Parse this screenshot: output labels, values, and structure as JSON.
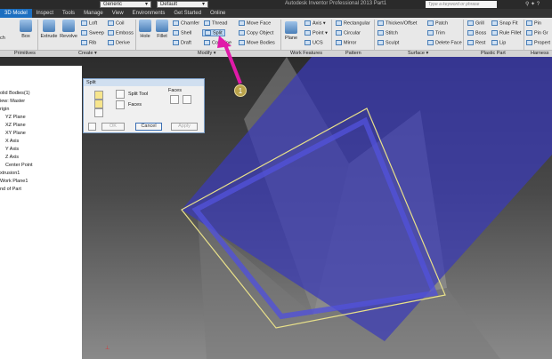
{
  "titlebar": {
    "appearance_value": "Generic",
    "style_value": "Default",
    "app_title": "Autodesk Inventor Professional 2013    Part1",
    "search_placeholder": "Type a keyword or phrase"
  },
  "tabs": [
    {
      "label": "3D Model",
      "active": true
    },
    {
      "label": "Inspect"
    },
    {
      "label": "Tools"
    },
    {
      "label": "Manage"
    },
    {
      "label": "View"
    },
    {
      "label": "Environments"
    },
    {
      "label": "Get Started"
    },
    {
      "label": "Online"
    }
  ],
  "ribbon": {
    "sketch": "ch",
    "box": "Box",
    "extrude": "Extrude",
    "revolve": "Revolve",
    "loft": "Loft",
    "sweep": "Sweep",
    "rib": "Rib",
    "coil": "Coil",
    "emboss": "Emboss",
    "derive": "Derive",
    "hole": "Hole",
    "fillet": "Fillet",
    "chamfer": "Chamfer",
    "shell": "Shell",
    "draft": "Draft",
    "thread": "Thread",
    "split": "Split",
    "combine": "Combine",
    "move_face": "Move Face",
    "copy_object": "Copy Object",
    "move_bodies": "Move Bodies",
    "plane": "Plane",
    "axis": "Axis",
    "point": "Point",
    "ucs": "UCS",
    "rectangular": "Rectangular",
    "circular": "Circular",
    "mirror": "Mirror",
    "thicken_offset": "Thicken/Offset",
    "stitch": "Stitch",
    "sculpt": "Sculpt",
    "patch": "Patch",
    "trim": "Trim",
    "delete_face": "Delete Face",
    "grill": "Grill",
    "boss": "Boss",
    "rest": "Rest",
    "snap_fit": "Snap Fit",
    "rule_fillet": "Rule Fillet",
    "lip": "Lip",
    "pin": "Pin",
    "pin_group": "Pin Gr",
    "properties": "Propert",
    "panels": {
      "primitives": "Primitives",
      "create": "Create ▾",
      "modify": "Modify ▾",
      "work_features": "Work Features",
      "pattern": "Pattern",
      "surface": "Surface ▾",
      "plastic_part": "Plastic Part",
      "harness": "Harness"
    }
  },
  "browser": {
    "items": [
      "olid Bodies(1)",
      "iew: Master",
      "rigin",
      "YZ Plane",
      "XZ Plane",
      "XY Plane",
      "X Axis",
      "Y Axis",
      "Z Axis",
      "Center Point",
      "xtrusion1",
      "Work Plane1",
      "nd of Part"
    ]
  },
  "split_dialog": {
    "title": "Split",
    "split_tool": "Split Tool",
    "faces": "Faces",
    "faces_group": "Faces",
    "ok": "OK",
    "cancel": "Cancel",
    "apply": "Apply"
  },
  "annotation": {
    "badge": "1"
  },
  "colors": {
    "accent_tab": "#1d6fc0",
    "annotation_arrow": "#e01aa8",
    "work_plane": "#3a3ab8",
    "edge_highlight": "#e8e08a"
  }
}
